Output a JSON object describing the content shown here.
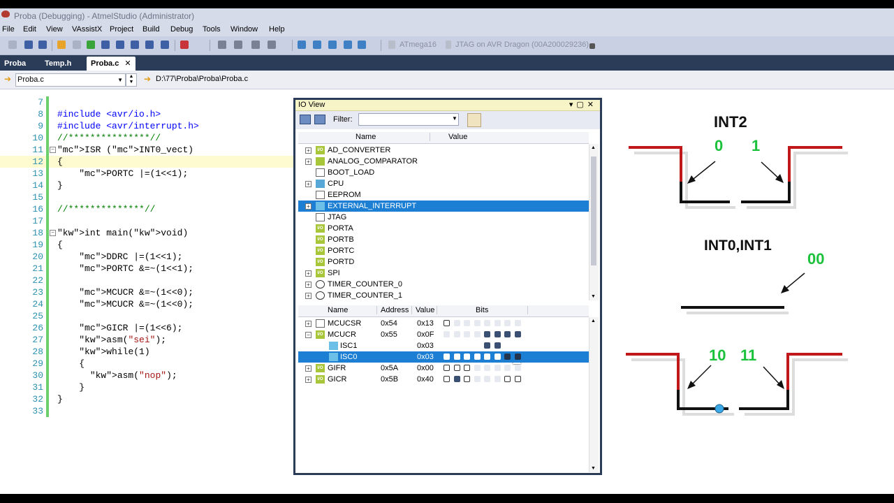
{
  "window": {
    "title": "Proba (Debugging) - AtmelStudio (Administrator)"
  },
  "menu": [
    "File",
    "Edit",
    "View",
    "VAssistX",
    "Project",
    "Build",
    "Debug",
    "Tools",
    "Window",
    "Help"
  ],
  "toolbar": {
    "device": "ATmega16",
    "tool": "JTAG on AVR Dragon (00A200029236)"
  },
  "tabs": [
    {
      "label": "Proba",
      "active": false
    },
    {
      "label": "Temp.h",
      "active": false
    },
    {
      "label": "Proba.c",
      "active": true
    }
  ],
  "pathbar": {
    "file_combo": "Proba.c",
    "path": "D:\\77\\Proba\\Proba\\Proba.c"
  },
  "editor": {
    "current_line": 12,
    "lines": [
      {
        "n": "7",
        "text": ""
      },
      {
        "n": "8",
        "text": "#include <avr/io.h>"
      },
      {
        "n": "9",
        "text": "#include <avr/interrupt.h>"
      },
      {
        "n": "10",
        "text": "//***************//"
      },
      {
        "n": "11",
        "text": "ISR (INT0_vect)"
      },
      {
        "n": "12",
        "text": "{"
      },
      {
        "n": "13",
        "text": "    PORTC |=(1<<1);"
      },
      {
        "n": "14",
        "text": "}"
      },
      {
        "n": "15",
        "text": ""
      },
      {
        "n": "16",
        "text": "//**************//"
      },
      {
        "n": "17",
        "text": ""
      },
      {
        "n": "18",
        "text": "int main(void)"
      },
      {
        "n": "19",
        "text": "{"
      },
      {
        "n": "20",
        "text": "    DDRC |=(1<<1);"
      },
      {
        "n": "21",
        "text": "    PORTC &=~(1<<1);"
      },
      {
        "n": "22",
        "text": ""
      },
      {
        "n": "23",
        "text": "    MCUCR &=~(1<<0);"
      },
      {
        "n": "24",
        "text": "    MCUCR &=~(1<<0);"
      },
      {
        "n": "25",
        "text": ""
      },
      {
        "n": "26",
        "text": "    GICR |=(1<<6);"
      },
      {
        "n": "27",
        "text": "    asm(\"sei\");"
      },
      {
        "n": "28",
        "text": "    while(1)"
      },
      {
        "n": "29",
        "text": "    {"
      },
      {
        "n": "30",
        "text": "      asm(\"nop\");"
      },
      {
        "n": "31",
        "text": "    }"
      },
      {
        "n": "32",
        "text": "}"
      },
      {
        "n": "33",
        "text": ""
      }
    ]
  },
  "io_view": {
    "title": "IO View",
    "filter_label": "Filter:",
    "filter_value": "",
    "columns_top": {
      "name": "Name",
      "value": "Value"
    },
    "modules": [
      {
        "name": "AD_CONVERTER",
        "icon": "io-icon",
        "expandable": true,
        "selected": false
      },
      {
        "name": "ANALOG_COMPARATOR",
        "icon": "adc-dac-icon",
        "expandable": true,
        "selected": false
      },
      {
        "name": "BOOT_LOAD",
        "icon": "page-icon",
        "expandable": false,
        "selected": false
      },
      {
        "name": "CPU",
        "icon": "chip-icon",
        "expandable": true,
        "selected": false
      },
      {
        "name": "EEPROM",
        "icon": "page-icon",
        "expandable": false,
        "selected": false
      },
      {
        "name": "EXTERNAL_INTERRUPT",
        "icon": "flash-icon",
        "expandable": true,
        "selected": true
      },
      {
        "name": "JTAG",
        "icon": "page-icon",
        "expandable": false,
        "selected": false
      },
      {
        "name": "PORTA",
        "icon": "io-icon",
        "expandable": false,
        "selected": false
      },
      {
        "name": "PORTB",
        "icon": "io-icon",
        "expandable": false,
        "selected": false
      },
      {
        "name": "PORTC",
        "icon": "io-icon",
        "expandable": false,
        "selected": false
      },
      {
        "name": "PORTD",
        "icon": "io-icon",
        "expandable": false,
        "selected": false
      },
      {
        "name": "SPI",
        "icon": "io-icon",
        "expandable": true,
        "selected": false
      },
      {
        "name": "TIMER_COUNTER_0",
        "icon": "clock-icon",
        "expandable": true,
        "selected": false
      },
      {
        "name": "TIMER_COUNTER_1",
        "icon": "clock-icon",
        "expandable": true,
        "selected": false
      }
    ],
    "columns_bottom": {
      "name": "Name",
      "address": "Address",
      "value": "Value",
      "bits": "Bits"
    },
    "registers": [
      {
        "name": "MCUCSR",
        "address": "0x54",
        "value": "0x13",
        "icon": "page-icon",
        "expand": "+",
        "indent": false,
        "selected": false,
        "bits": [
          "empty",
          "faint",
          "faint",
          "faint",
          "faint",
          "faint",
          "faint",
          "faint"
        ]
      },
      {
        "name": "MCUCR",
        "address": "0x55",
        "value": "0x0F",
        "icon": "io-icon",
        "expand": "-",
        "indent": false,
        "selected": false,
        "bits": [
          "faint",
          "faint",
          "faint",
          "faint",
          "fill",
          "fill",
          "fill",
          "fill"
        ]
      },
      {
        "name": "ISC1",
        "address": "",
        "value": "0x03",
        "icon": "flash-icon",
        "expand": "",
        "indent": true,
        "selected": false,
        "bits": [
          "",
          "",
          "",
          "",
          "fill",
          "fill",
          "",
          ""
        ]
      },
      {
        "name": "ISC0",
        "address": "",
        "value": "0x03",
        "icon": "flash-icon",
        "expand": "",
        "indent": true,
        "selected": true,
        "bits": [
          "white",
          "white",
          "white",
          "white",
          "white",
          "white",
          "dark",
          "dark"
        ]
      },
      {
        "name": "GIFR",
        "address": "0x5A",
        "value": "0x00",
        "icon": "io-icon",
        "expand": "+",
        "indent": false,
        "selected": false,
        "bits": [
          "empty",
          "empty",
          "empty",
          "faint",
          "faint",
          "faint",
          "faint",
          "faint"
        ]
      },
      {
        "name": "GICR",
        "address": "0x5B",
        "value": "0x40",
        "icon": "io-icon",
        "expand": "+",
        "indent": false,
        "selected": false,
        "bits": [
          "empty",
          "fill",
          "empty",
          "faint",
          "faint",
          "faint",
          "empty",
          "empty"
        ]
      }
    ]
  },
  "diagram": {
    "int2_title": "INT2",
    "int2_bits": [
      "0",
      "1"
    ],
    "int01_title": "INT0,INT1",
    "int01_bits_low": "00",
    "int01_bits_edges": [
      "10",
      "11"
    ]
  }
}
